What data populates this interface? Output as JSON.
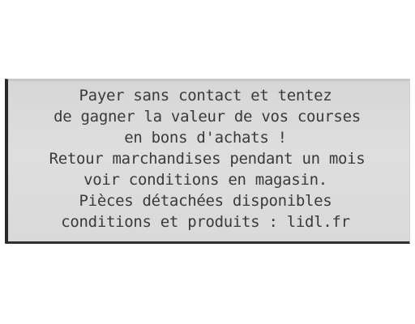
{
  "receipt": {
    "lines": [
      "Payer sans contact et tentez",
      "de gagner la valeur de vos courses",
      "en bons d'achats !",
      "Retour marchandises pendant un mois",
      "voir conditions en magasin.",
      "Pièces détachées disponibles",
      "conditions et produits : lidl.fr"
    ]
  }
}
